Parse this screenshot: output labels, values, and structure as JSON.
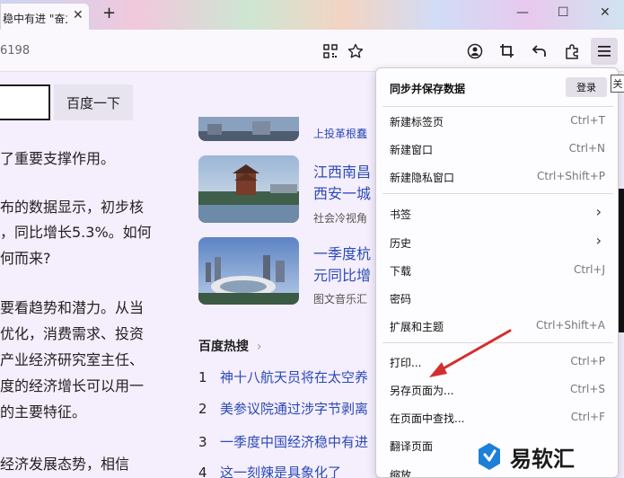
{
  "tab": {
    "title": "稳中有进 \"奋力",
    "close": "✕"
  },
  "newtab": "+",
  "window": {
    "minimize": "—",
    "maximize": "☐",
    "close": "✕"
  },
  "url": {
    "text": "6198"
  },
  "search": {
    "button": "百度一下"
  },
  "article": {
    "lines": [
      "了重要支撑作用。",
      "布的数据显示，初步核",
      "，同比增长5.3%。如何",
      "何而来?",
      "要看趋势和潜力。从当",
      "优化，消费需求、投资",
      "产业经济研究室主任、",
      "度的经济增长可以用一",
      "的主要特征。",
      "经济发展态势，相信"
    ]
  },
  "news": [
    {
      "title": "江西南昌",
      "title2": "西安一城",
      "source": "社会冷视角"
    },
    {
      "title": "一季度杭",
      "title2": "元同比增",
      "source": "图文音乐汇"
    }
  ],
  "news_top_snippet": "上投革根蠢",
  "hot": {
    "title": "百度热搜",
    "arrow": "›",
    "items": [
      {
        "num": "1",
        "text": "神十八航天员将在太空养"
      },
      {
        "num": "2",
        "text": "美参议院通过涉字节剥离"
      },
      {
        "num": "3",
        "text": "一季度中国经济稳中有进"
      },
      {
        "num": "4",
        "text": "这一刻辣是具象化了"
      }
    ]
  },
  "menu": {
    "sync_heading": "同步并保存数据",
    "login": "登录",
    "items": [
      {
        "label": "新建标签页",
        "shortcut": "Ctrl+T"
      },
      {
        "label": "新建窗口",
        "shortcut": "Ctrl+N"
      },
      {
        "label": "新建隐私窗口",
        "shortcut": "Ctrl+Shift+P"
      },
      {
        "label": "书签",
        "shortcut": ""
      },
      {
        "label": "历史",
        "shortcut": ""
      },
      {
        "label": "下载",
        "shortcut": "Ctrl+J"
      },
      {
        "label": "密码",
        "shortcut": ""
      },
      {
        "label": "扩展和主题",
        "shortcut": "Ctrl+Shift+A"
      },
      {
        "label": "打印...",
        "shortcut": "Ctrl+P"
      },
      {
        "label": "另存页面为...",
        "shortcut": "Ctrl+S"
      },
      {
        "label": "在页面中查找...",
        "shortcut": "Ctrl+F"
      },
      {
        "label": "翻译页面",
        "shortcut": ""
      },
      {
        "label": "缩放",
        "shortcut": ""
      }
    ],
    "chevron": "›"
  },
  "edge_close": "关",
  "watermark": {
    "text": "易软汇"
  },
  "colors": {
    "accent_link": "#2a4bb6",
    "arrow": "#d32f2f",
    "watermark_blue": "#1e7fd8"
  }
}
